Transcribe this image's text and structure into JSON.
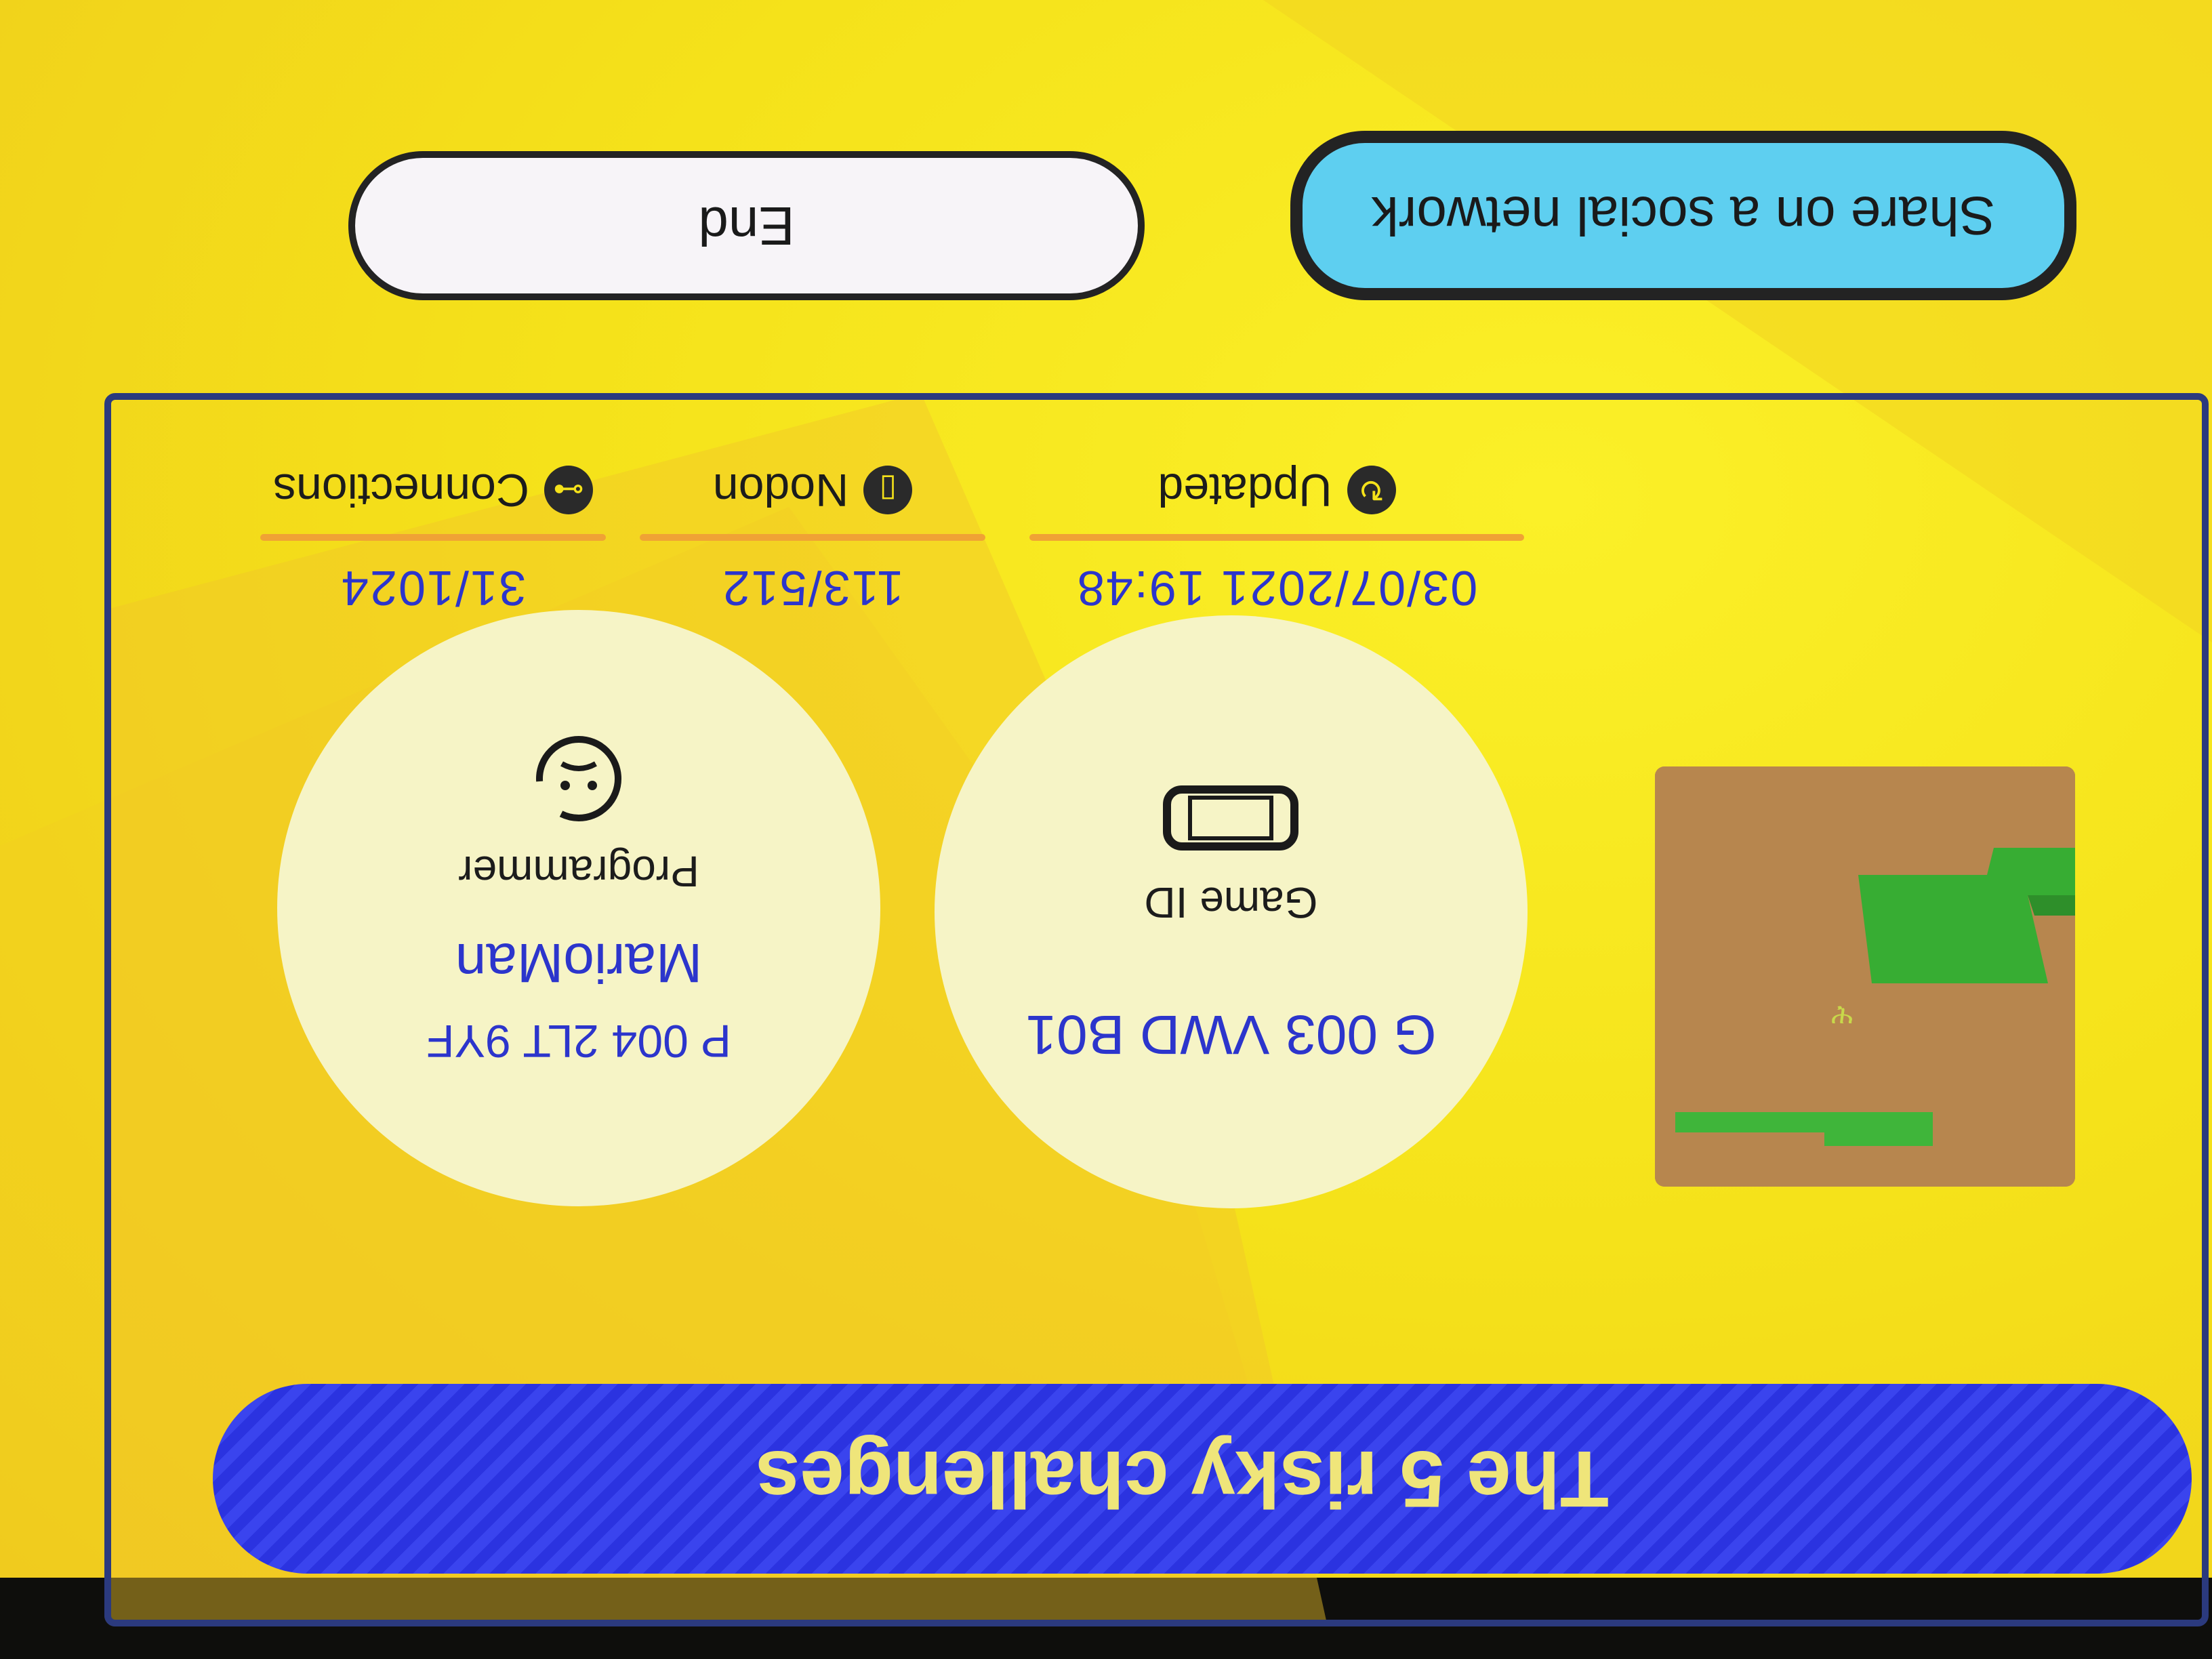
{
  "level": {
    "title": "The 5 risky challenges"
  },
  "game_id": {
    "label": "Game ID",
    "value": "G 003 VWD B01"
  },
  "programmer": {
    "label": "Programmer",
    "name": "MarioMan",
    "id": "P 004 2LT 9YF"
  },
  "stats": [
    {
      "label": "Updated",
      "value": "03/07/2021 19:48",
      "icon": "refresh-icon"
    },
    {
      "label": "Nodon",
      "value": "113/512",
      "icon": "nodon-icon"
    },
    {
      "label": "Connections",
      "value": "31/1024",
      "icon": "connection-icon"
    }
  ],
  "buttons": {
    "share_label": "Share on a social network",
    "end_label": "End"
  },
  "colors": {
    "background": "#f5e21a",
    "title_bar": "#2b33e0",
    "title_text": "#efe57a",
    "value_text": "#2c35cc",
    "stat_underline": "#f0a235",
    "share_button": "#5ecff0"
  }
}
